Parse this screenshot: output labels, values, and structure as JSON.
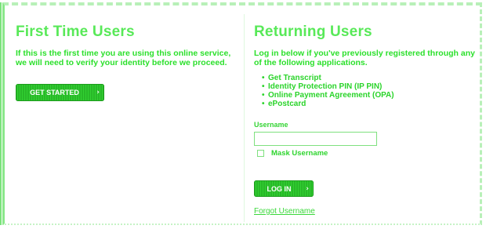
{
  "first_time": {
    "heading": "First Time Users",
    "description": "If this is the first time you are using this online service, we will need to verify your identity before we proceed.",
    "button_label": "GET STARTED",
    "button_chevron": "›"
  },
  "returning": {
    "heading": "Returning Users",
    "description": "Log in below if you've previously registered through any of the following applications.",
    "applications": [
      "Get Transcript",
      "Identity Protection PIN (IP PIN)",
      "Online Payment Agreement (OPA)",
      "ePostcard"
    ],
    "username_label": "Username",
    "username_value": "",
    "mask_label": "Mask Username",
    "login_label": "LOG IN",
    "login_chevron": "›",
    "forgot_link": "Forgot Username"
  },
  "colors": {
    "accent": "#22dd22",
    "button": "#28b828"
  }
}
